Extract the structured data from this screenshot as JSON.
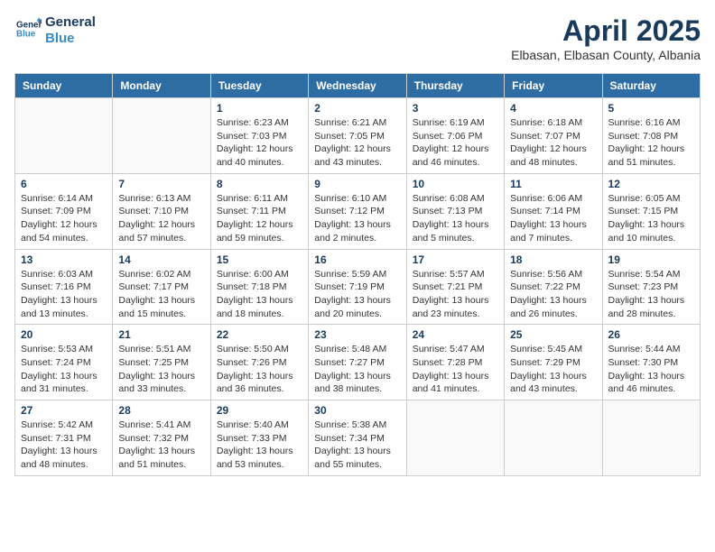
{
  "header": {
    "logo_line1": "General",
    "logo_line2": "Blue",
    "title": "April 2025",
    "subtitle": "Elbasan, Elbasan County, Albania"
  },
  "weekdays": [
    "Sunday",
    "Monday",
    "Tuesday",
    "Wednesday",
    "Thursday",
    "Friday",
    "Saturday"
  ],
  "weeks": [
    [
      {
        "day": "",
        "info": ""
      },
      {
        "day": "",
        "info": ""
      },
      {
        "day": "1",
        "info": "Sunrise: 6:23 AM\nSunset: 7:03 PM\nDaylight: 12 hours and 40 minutes."
      },
      {
        "day": "2",
        "info": "Sunrise: 6:21 AM\nSunset: 7:05 PM\nDaylight: 12 hours and 43 minutes."
      },
      {
        "day": "3",
        "info": "Sunrise: 6:19 AM\nSunset: 7:06 PM\nDaylight: 12 hours and 46 minutes."
      },
      {
        "day": "4",
        "info": "Sunrise: 6:18 AM\nSunset: 7:07 PM\nDaylight: 12 hours and 48 minutes."
      },
      {
        "day": "5",
        "info": "Sunrise: 6:16 AM\nSunset: 7:08 PM\nDaylight: 12 hours and 51 minutes."
      }
    ],
    [
      {
        "day": "6",
        "info": "Sunrise: 6:14 AM\nSunset: 7:09 PM\nDaylight: 12 hours and 54 minutes."
      },
      {
        "day": "7",
        "info": "Sunrise: 6:13 AM\nSunset: 7:10 PM\nDaylight: 12 hours and 57 minutes."
      },
      {
        "day": "8",
        "info": "Sunrise: 6:11 AM\nSunset: 7:11 PM\nDaylight: 12 hours and 59 minutes."
      },
      {
        "day": "9",
        "info": "Sunrise: 6:10 AM\nSunset: 7:12 PM\nDaylight: 13 hours and 2 minutes."
      },
      {
        "day": "10",
        "info": "Sunrise: 6:08 AM\nSunset: 7:13 PM\nDaylight: 13 hours and 5 minutes."
      },
      {
        "day": "11",
        "info": "Sunrise: 6:06 AM\nSunset: 7:14 PM\nDaylight: 13 hours and 7 minutes."
      },
      {
        "day": "12",
        "info": "Sunrise: 6:05 AM\nSunset: 7:15 PM\nDaylight: 13 hours and 10 minutes."
      }
    ],
    [
      {
        "day": "13",
        "info": "Sunrise: 6:03 AM\nSunset: 7:16 PM\nDaylight: 13 hours and 13 minutes."
      },
      {
        "day": "14",
        "info": "Sunrise: 6:02 AM\nSunset: 7:17 PM\nDaylight: 13 hours and 15 minutes."
      },
      {
        "day": "15",
        "info": "Sunrise: 6:00 AM\nSunset: 7:18 PM\nDaylight: 13 hours and 18 minutes."
      },
      {
        "day": "16",
        "info": "Sunrise: 5:59 AM\nSunset: 7:19 PM\nDaylight: 13 hours and 20 minutes."
      },
      {
        "day": "17",
        "info": "Sunrise: 5:57 AM\nSunset: 7:21 PM\nDaylight: 13 hours and 23 minutes."
      },
      {
        "day": "18",
        "info": "Sunrise: 5:56 AM\nSunset: 7:22 PM\nDaylight: 13 hours and 26 minutes."
      },
      {
        "day": "19",
        "info": "Sunrise: 5:54 AM\nSunset: 7:23 PM\nDaylight: 13 hours and 28 minutes."
      }
    ],
    [
      {
        "day": "20",
        "info": "Sunrise: 5:53 AM\nSunset: 7:24 PM\nDaylight: 13 hours and 31 minutes."
      },
      {
        "day": "21",
        "info": "Sunrise: 5:51 AM\nSunset: 7:25 PM\nDaylight: 13 hours and 33 minutes."
      },
      {
        "day": "22",
        "info": "Sunrise: 5:50 AM\nSunset: 7:26 PM\nDaylight: 13 hours and 36 minutes."
      },
      {
        "day": "23",
        "info": "Sunrise: 5:48 AM\nSunset: 7:27 PM\nDaylight: 13 hours and 38 minutes."
      },
      {
        "day": "24",
        "info": "Sunrise: 5:47 AM\nSunset: 7:28 PM\nDaylight: 13 hours and 41 minutes."
      },
      {
        "day": "25",
        "info": "Sunrise: 5:45 AM\nSunset: 7:29 PM\nDaylight: 13 hours and 43 minutes."
      },
      {
        "day": "26",
        "info": "Sunrise: 5:44 AM\nSunset: 7:30 PM\nDaylight: 13 hours and 46 minutes."
      }
    ],
    [
      {
        "day": "27",
        "info": "Sunrise: 5:42 AM\nSunset: 7:31 PM\nDaylight: 13 hours and 48 minutes."
      },
      {
        "day": "28",
        "info": "Sunrise: 5:41 AM\nSunset: 7:32 PM\nDaylight: 13 hours and 51 minutes."
      },
      {
        "day": "29",
        "info": "Sunrise: 5:40 AM\nSunset: 7:33 PM\nDaylight: 13 hours and 53 minutes."
      },
      {
        "day": "30",
        "info": "Sunrise: 5:38 AM\nSunset: 7:34 PM\nDaylight: 13 hours and 55 minutes."
      },
      {
        "day": "",
        "info": ""
      },
      {
        "day": "",
        "info": ""
      },
      {
        "day": "",
        "info": ""
      }
    ]
  ]
}
